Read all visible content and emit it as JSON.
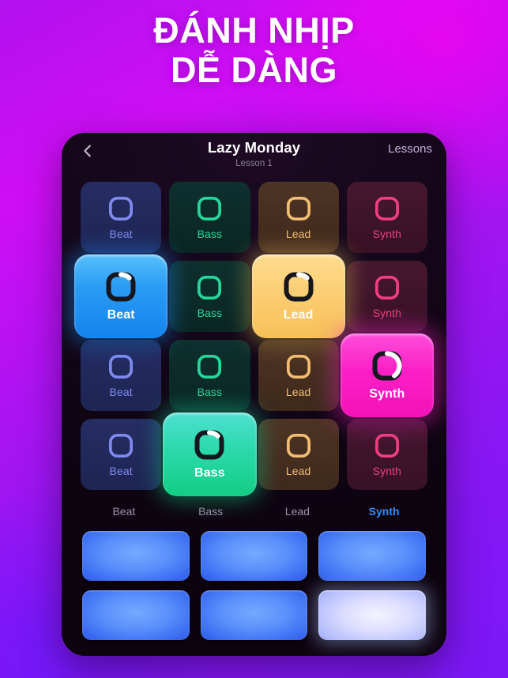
{
  "headline": {
    "line1": "ĐÁNH NHỊP",
    "line2": "DỄ DÀNG"
  },
  "app": {
    "navbar": {
      "back_icon": "chevron-left-icon",
      "title": "Lazy Monday",
      "subtitle": "Lesson 1",
      "lessons_link": "Lessons"
    },
    "track_grid": {
      "rows": [
        [
          {
            "label": "Beat",
            "instrument": "beat",
            "active": false,
            "progress": 0
          },
          {
            "label": "Bass",
            "instrument": "bass",
            "active": false,
            "progress": 0
          },
          {
            "label": "Lead",
            "instrument": "lead",
            "active": false,
            "progress": 0
          },
          {
            "label": "Synth",
            "instrument": "synth",
            "active": false,
            "progress": 0
          }
        ],
        [
          {
            "label": "Beat",
            "instrument": "beat",
            "active": true,
            "progress": 12
          },
          {
            "label": "Bass",
            "instrument": "bass",
            "active": false,
            "progress": 0
          },
          {
            "label": "Lead",
            "instrument": "lead",
            "active": true,
            "progress": 12
          },
          {
            "label": "Synth",
            "instrument": "synth",
            "active": false,
            "progress": 0
          }
        ],
        [
          {
            "label": "Beat",
            "instrument": "beat",
            "active": false,
            "progress": 0
          },
          {
            "label": "Bass",
            "instrument": "bass",
            "active": false,
            "progress": 0
          },
          {
            "label": "Lead",
            "instrument": "lead",
            "active": false,
            "progress": 0
          },
          {
            "label": "Synth",
            "instrument": "synth",
            "active": true,
            "progress": 40
          }
        ],
        [
          {
            "label": "Beat",
            "instrument": "beat",
            "active": false,
            "progress": 0
          },
          {
            "label": "Bass",
            "instrument": "bass",
            "active": true,
            "progress": 12
          },
          {
            "label": "Lead",
            "instrument": "lead",
            "active": false,
            "progress": 0
          },
          {
            "label": "Synth",
            "instrument": "synth",
            "active": false,
            "progress": 0
          }
        ]
      ]
    },
    "tabs": [
      {
        "label": "Beat",
        "selected": false
      },
      {
        "label": "Bass",
        "selected": false
      },
      {
        "label": "Lead",
        "selected": false
      },
      {
        "label": "Synth",
        "selected": true
      }
    ],
    "drum_pads": [
      {
        "id": 1,
        "lit": false
      },
      {
        "id": 2,
        "lit": false
      },
      {
        "id": 3,
        "lit": false
      },
      {
        "id": 4,
        "lit": false
      },
      {
        "id": 5,
        "lit": false
      },
      {
        "id": 6,
        "lit": true
      }
    ]
  },
  "colors": {
    "background_start": "#cf0ef4",
    "background_end": "#7a18f6",
    "phone_body": "#120617",
    "beat": "#2b9cf4",
    "bass": "#12cd84",
    "lead": "#fbcb6e",
    "synth": "#fb20c6",
    "tab_selected": "#2f8bfb",
    "drum_pad": "#5b8ffb"
  }
}
